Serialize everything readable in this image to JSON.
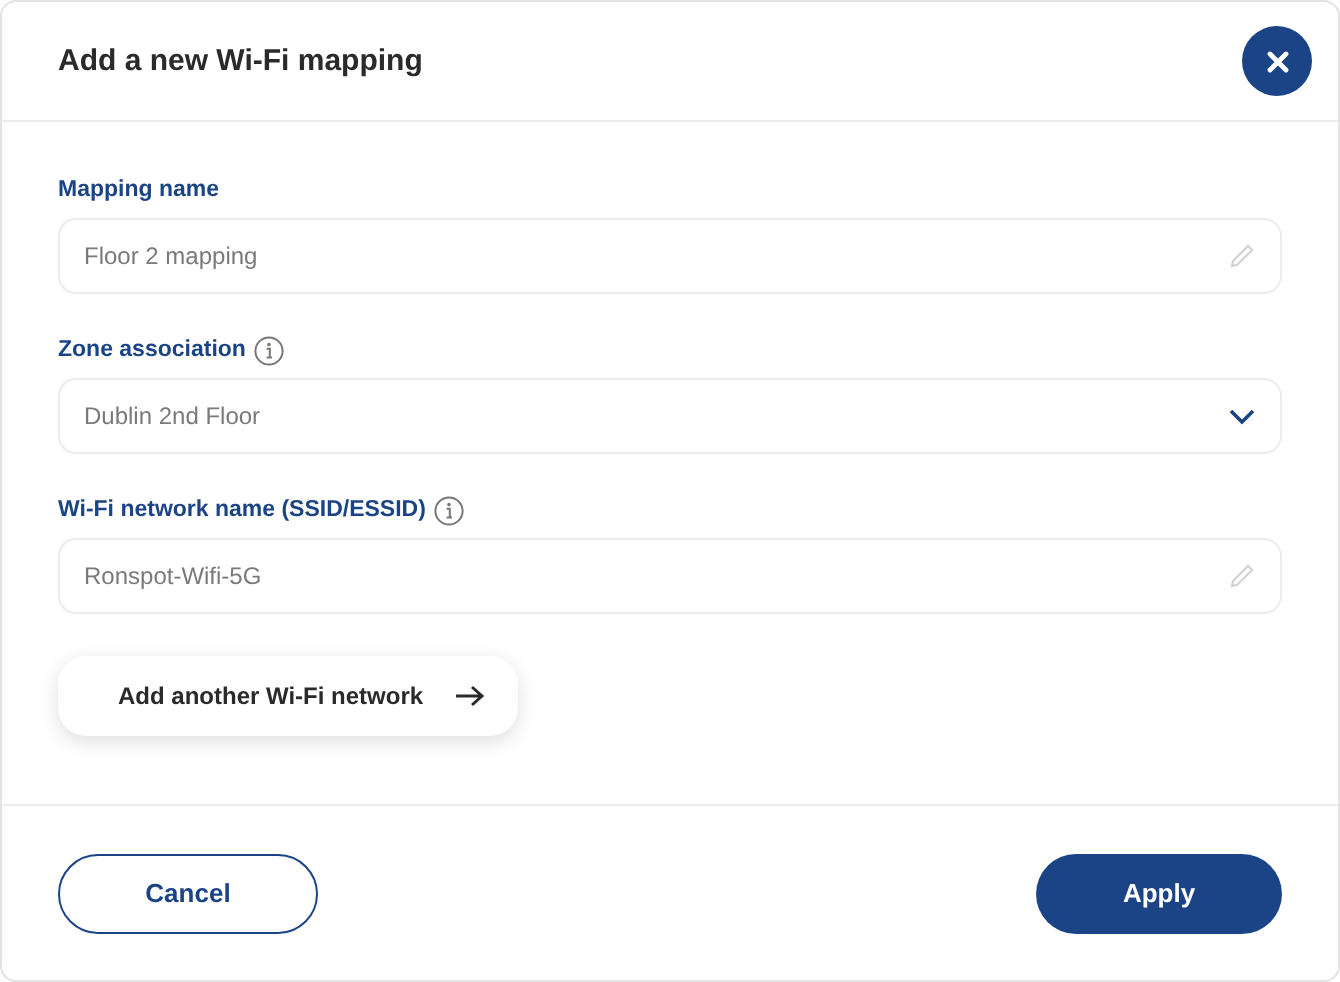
{
  "dialog": {
    "title": "Add a new Wi-Fi mapping"
  },
  "fields": [
    {
      "kind": "text",
      "label": "Mapping name",
      "info": false,
      "value": "Floor 2 mapping"
    },
    {
      "kind": "select",
      "label": "Zone association",
      "info": true,
      "value": "Dublin 2nd Floor"
    },
    {
      "kind": "text",
      "label": "Wi-Fi network name (SSID/ESSID)",
      "info": true,
      "value": "Ronspot-Wifi-5G"
    }
  ],
  "add_button": {
    "label": "Add another Wi-Fi network"
  },
  "footer": {
    "cancel": "Cancel",
    "apply": "Apply"
  }
}
